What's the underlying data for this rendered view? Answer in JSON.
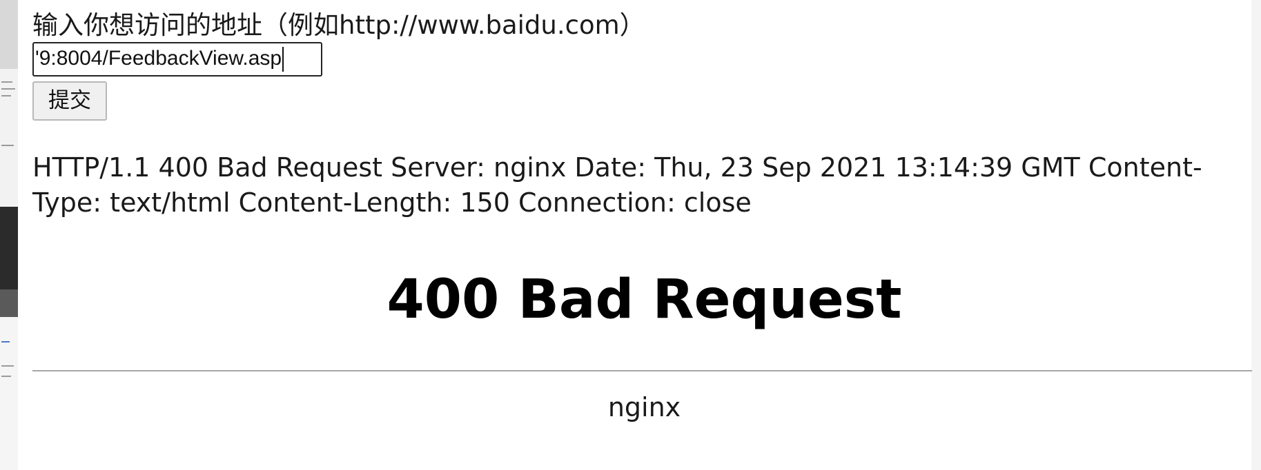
{
  "form": {
    "label": "输入你想访问的地址（例如http://www.baidu.com）",
    "url_value": "'9:8004/FeedbackView.asp",
    "submit_label": "提交"
  },
  "response": {
    "raw_headers": "HTTP/1.1 400 Bad Request Server: nginx Date: Thu, 23 Sep 2021 13:14:39 GMT Content-Type: text/html Content-Length: 150 Connection: close"
  },
  "error_page": {
    "heading": "400 Bad Request",
    "server": "nginx"
  }
}
